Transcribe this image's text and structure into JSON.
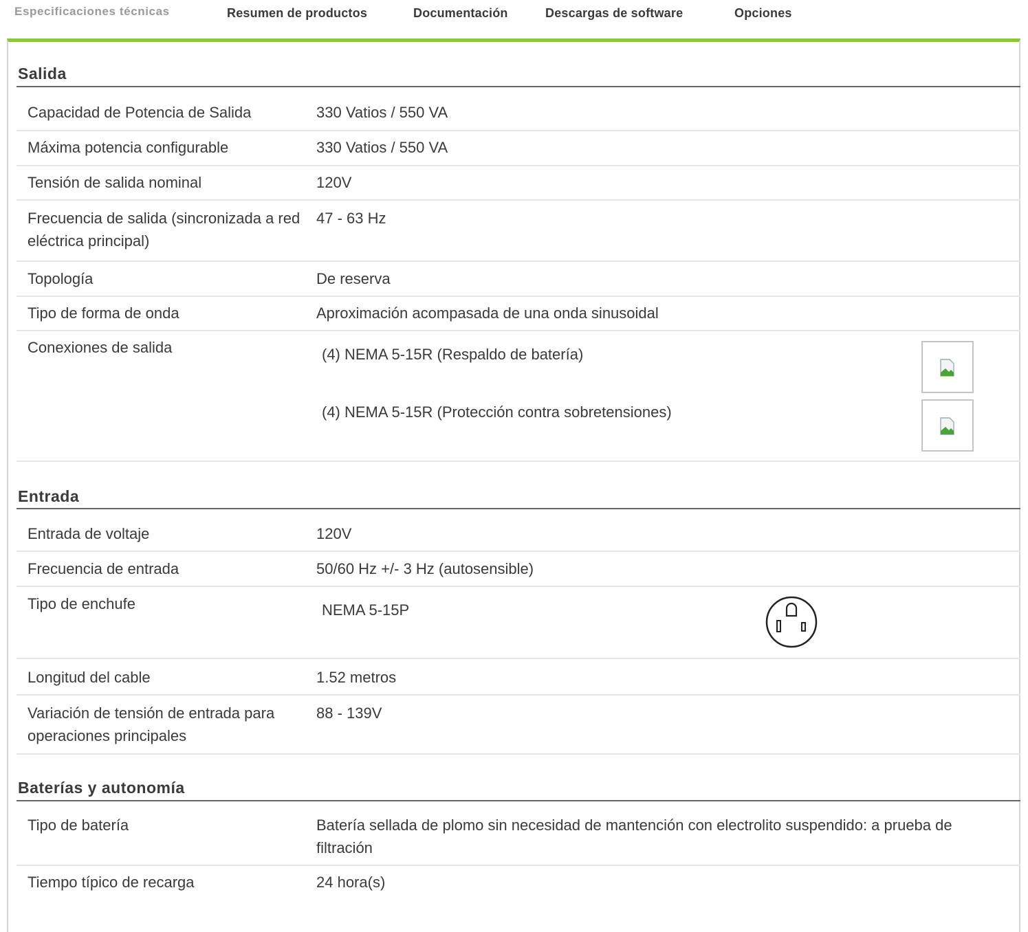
{
  "tabs": [
    {
      "label": "Especificaciones técnicas",
      "active": true
    },
    {
      "label": "Resumen de productos"
    },
    {
      "label": "Documentación"
    },
    {
      "label": "Descargas de software"
    },
    {
      "label": "Opciones"
    }
  ],
  "accent_color": "#8cc63f",
  "sections": {
    "salida": {
      "title": "Salida",
      "rows": [
        {
          "label": "Capacidad de Potencia de Salida",
          "value": "330 Vatios / 550 VA"
        },
        {
          "label": "Máxima potencia configurable",
          "value": "330 Vatios / 550 VA"
        },
        {
          "label": "Tensión de salida nominal",
          "value": "120V"
        },
        {
          "label": "Frecuencia de salida (sincronizada a red eléctrica principal)",
          "value": "47 - 63 Hz"
        },
        {
          "label": "Topología",
          "value": "De reserva"
        },
        {
          "label": "Tipo de forma de onda",
          "value": "Aproximación acompasada de una onda sinusoidal"
        },
        {
          "label": "Conexiones de salida",
          "values": [
            {
              "text": "(4) NEMA 5-15R (Respaldo de batería)",
              "icon": "broken-image-icon"
            },
            {
              "text": "(4) NEMA 5-15R (Protección contra sobretensiones)",
              "icon": "broken-image-icon"
            }
          ]
        }
      ]
    },
    "entrada": {
      "title": "Entrada",
      "rows": [
        {
          "label": "Entrada de voltaje",
          "value": "120V"
        },
        {
          "label": "Frecuencia de entrada",
          "value": "50/60 Hz +/- 3 Hz (autosensible)"
        },
        {
          "label": "Tipo de enchufe",
          "value": "NEMA 5-15P",
          "icon": "nema-5-15p-plug-icon"
        },
        {
          "label": "Longitud del cable",
          "value": "1.52 metros"
        },
        {
          "label": "Variación de tensión de entrada para operaciones principales",
          "value": "88 - 139V"
        }
      ]
    },
    "baterias": {
      "title": "Baterías y autonomía",
      "rows": [
        {
          "label": "Tipo de batería",
          "value": "Batería sellada de plomo sin necesidad de mantención con electrolito suspendido: a prueba de filtración"
        },
        {
          "label": "Tiempo típico de recarga",
          "value": "24 hora(s)"
        }
      ]
    }
  }
}
